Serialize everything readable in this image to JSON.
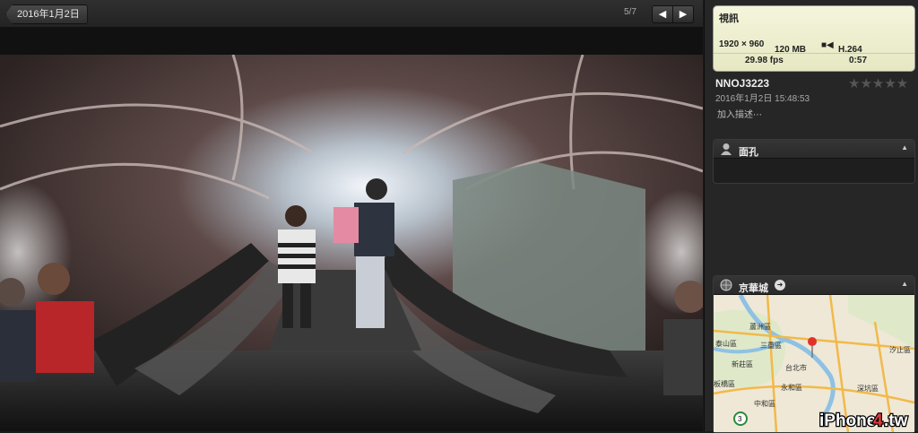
{
  "toolbar": {
    "back_label": "2016年1月2日",
    "counter": "5/7",
    "prev_icon": "arrow-left",
    "next_icon": "arrow-right"
  },
  "info": {
    "header": "視訊",
    "resolution": "1920 × 960",
    "size": "120 MB",
    "codec": "H.264",
    "fps": "29.98 fps",
    "duration": "0:57"
  },
  "photo": {
    "title": "NNOJ3223",
    "datetime": "2016年1月2日 15:48:53",
    "description_placeholder": "加入描述⋯",
    "rating_stars": "★★★★★",
    "rating": 0
  },
  "faces": {
    "label": "面孔"
  },
  "location": {
    "label": "京華城",
    "map_labels": [
      "蘆洲區",
      "泰山區",
      "三重區",
      "新莊區",
      "台北市",
      "板橋區",
      "永和區",
      "深坑區",
      "中和區",
      "汐止區"
    ],
    "route_badge": "3",
    "watermark_pre": "iPhone",
    "watermark_mid": "4",
    "watermark_post": ".tw"
  },
  "colors": {
    "accent_pin": "#e0322b",
    "card_bg": "#eef0cf"
  }
}
